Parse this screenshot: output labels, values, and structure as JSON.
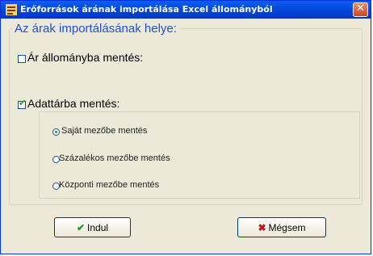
{
  "window": {
    "title": "Erőforrások árának importálása Excel állományból",
    "app_icon": "excel-import-icon",
    "close_glyph": "✕"
  },
  "group": {
    "title": "Az árak importálásának helye:"
  },
  "options": {
    "file_save": {
      "label": "Ár állományba mentés:",
      "checked": false
    },
    "db_save": {
      "label": "Adattárba mentés:",
      "checked": true
    }
  },
  "radios": [
    {
      "label": "Saját mezőbe mentés",
      "selected": true
    },
    {
      "label": "Százalékos mezőbe mentés",
      "selected": false
    },
    {
      "label": "Központi mezőbe mentés",
      "selected": false
    }
  ],
  "buttons": {
    "ok": {
      "label": "Indul",
      "icon": "checkmark-icon",
      "glyph": "✔"
    },
    "cancel": {
      "label": "Mégsem",
      "icon": "cross-icon",
      "glyph": "✖"
    }
  },
  "colors": {
    "title_blue": "#0343d8",
    "group_title": "#1f4fd8"
  }
}
